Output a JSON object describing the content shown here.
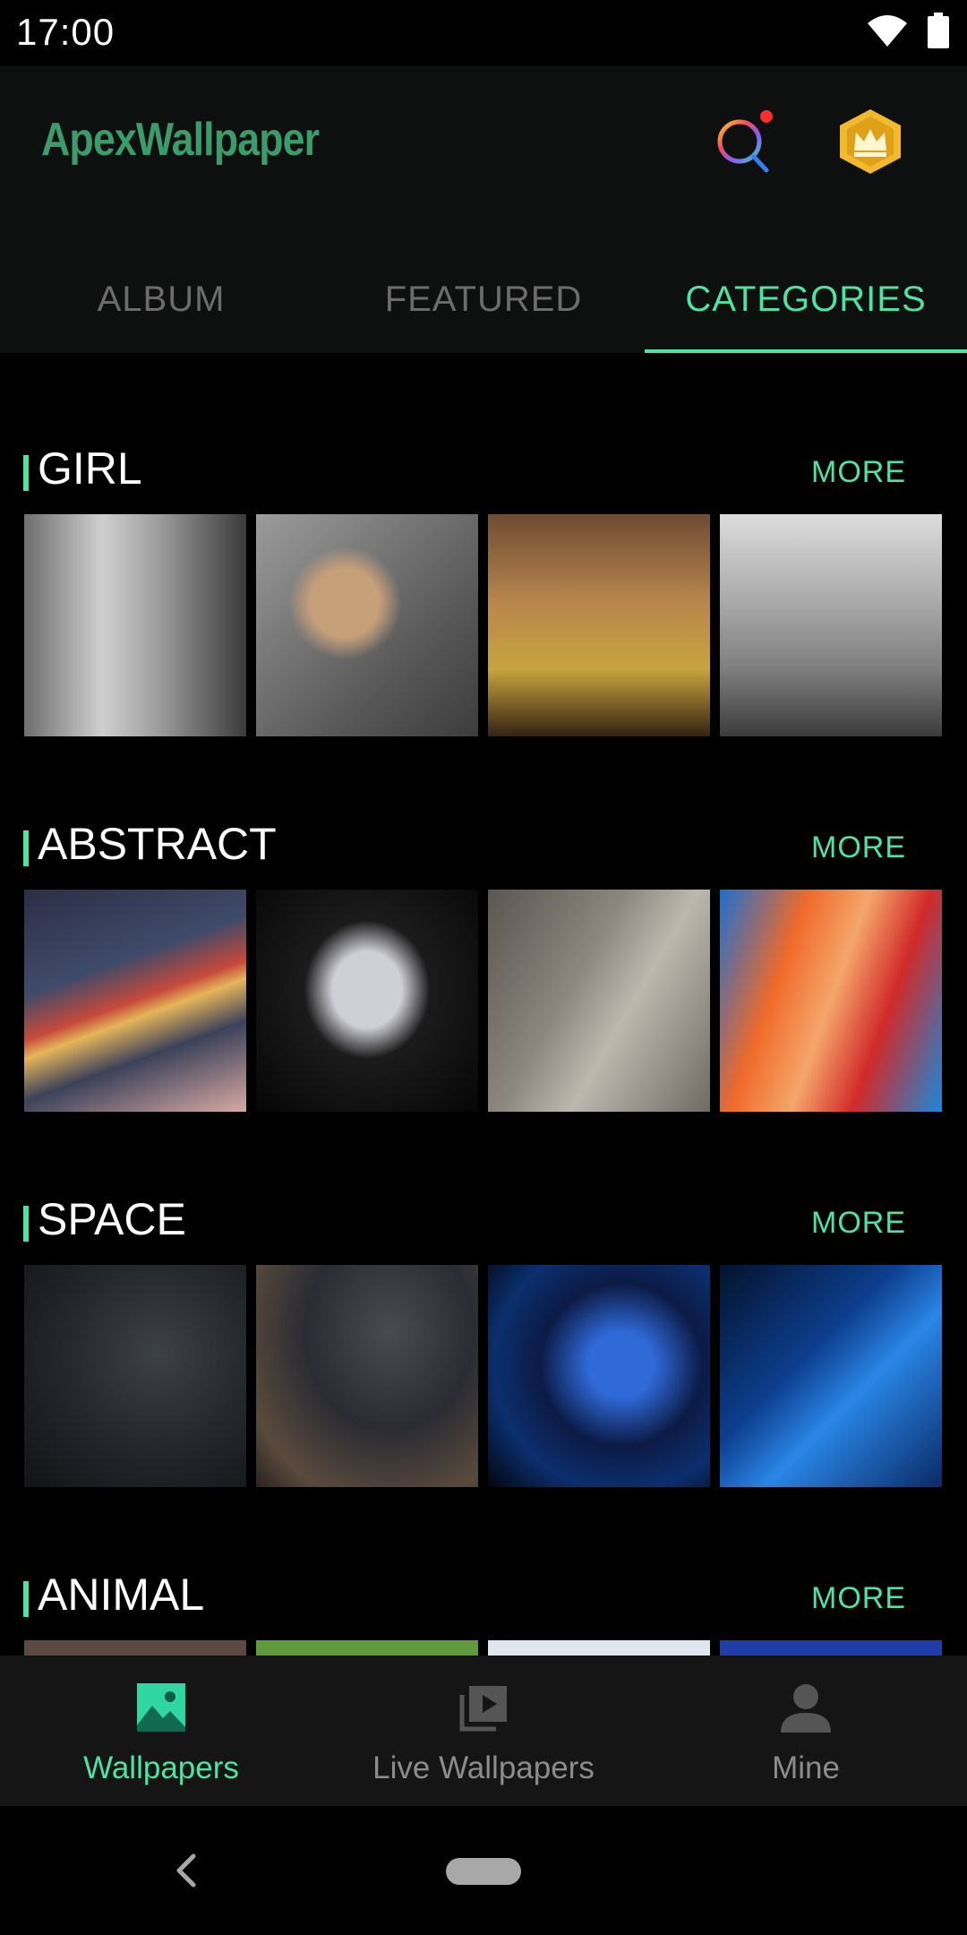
{
  "status_bar": {
    "time": "17:00",
    "icons": [
      "wifi-icon",
      "battery-icon"
    ]
  },
  "header": {
    "app_title": "ApexWallpaper",
    "search_icon": "search-icon",
    "premium_icon": "crown-icon",
    "notification_dot_color": "#ff2d2d"
  },
  "tabs": [
    {
      "label": "ALBUM",
      "active": false
    },
    {
      "label": "FEATURED",
      "active": false
    },
    {
      "label": "CATEGORIES",
      "active": true
    }
  ],
  "sections": [
    {
      "title": "GIRL",
      "more_label": "MORE",
      "thumbnails": [
        "girl-wallpaper-1",
        "girl-wallpaper-2",
        "girl-wallpaper-3",
        "girl-wallpaper-4"
      ]
    },
    {
      "title": "ABSTRACT",
      "more_label": "MORE",
      "thumbnails": [
        "abstract-wallpaper-1",
        "abstract-wallpaper-2",
        "abstract-wallpaper-3",
        "abstract-wallpaper-4"
      ]
    },
    {
      "title": "SPACE",
      "more_label": "MORE",
      "thumbnails": [
        "space-wallpaper-1",
        "space-wallpaper-2",
        "space-wallpaper-3",
        "space-wallpaper-4"
      ]
    },
    {
      "title": "ANIMAL",
      "more_label": "MORE",
      "thumbnails": [
        "animal-wallpaper-1",
        "animal-wallpaper-2",
        "animal-wallpaper-3",
        "animal-wallpaper-4"
      ]
    }
  ],
  "bottom_nav": [
    {
      "label": "Wallpapers",
      "icon": "image-icon",
      "active": true
    },
    {
      "label": "Live Wallpapers",
      "icon": "video-stack-icon",
      "active": false
    },
    {
      "label": "Mine",
      "icon": "person-icon",
      "active": false
    }
  ],
  "system_nav": {
    "back_icon": "back-icon",
    "home_icon": "home-pill-icon"
  },
  "colors": {
    "accent": "#4fe3a2",
    "title_green": "#3c9b6a",
    "header_bg": "#0e0f0f",
    "nav_bg": "#151515",
    "inactive_text": "#6c6c6c",
    "crown_gold": "#f2b92c"
  }
}
